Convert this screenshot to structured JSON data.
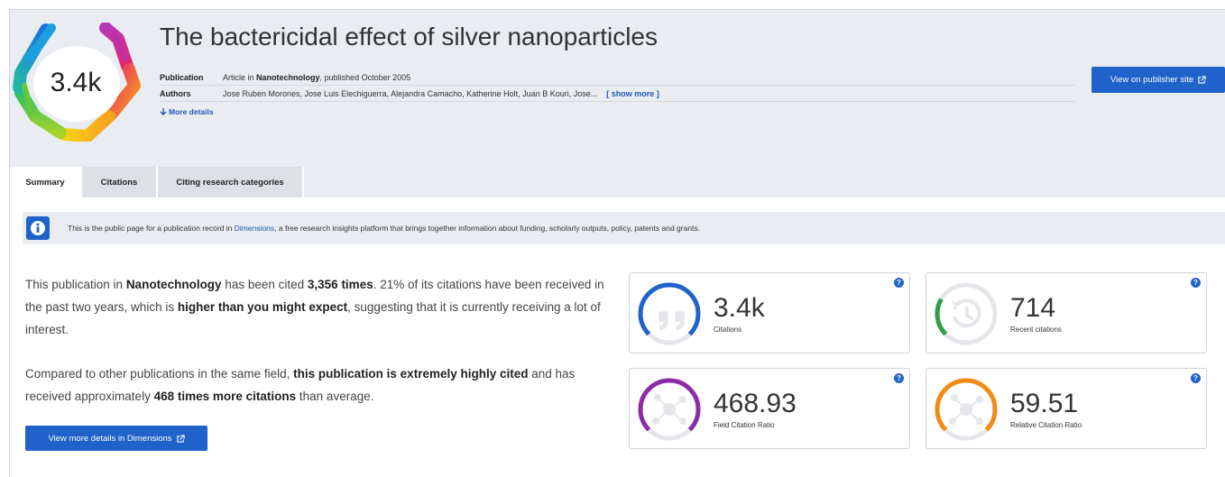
{
  "badge": {
    "value": "3.4k",
    "icon": "altmetric-hexagon-icon"
  },
  "publication": {
    "title": "The bactericidal effect of silver nanoparticles",
    "publication_label": "Publication",
    "publication_prefix": "Article in",
    "journal": "Nanotechnology",
    "publication_suffix": ", published October 2005",
    "authors_label": "Authors",
    "authors": "Jose Ruben Morones, Jose Luis Elechiguerra, Alejandra Camacho, Katherine Holt, Juan B Kouri, Jose...",
    "show_more": "[ show more ]",
    "more_details": "More details"
  },
  "actions": {
    "publisher_button": "View on publisher site",
    "dimensions_button": "View more details in Dimensions"
  },
  "tabs": [
    {
      "label": "Summary",
      "active": true
    },
    {
      "label": "Citations",
      "active": false
    },
    {
      "label": "Citing research categories",
      "active": false
    }
  ],
  "info": {
    "text_before": "This is the public page for a publication record in ",
    "link": "Dimensions",
    "text_after": ", a free research insights platform that brings together information about funding, scholarly outputs, policy, patents and grants."
  },
  "summary": {
    "p1_a": "This publication in ",
    "p1_journal": "Nanotechnology",
    "p1_b": " has been cited ",
    "p1_count": "3,356 times",
    "p1_c": ". 21% of its citations have been received in the past two years, which is ",
    "p1_expect": "higher than you might expect",
    "p1_d": ", suggesting that it is currently receiving a lot of interest.",
    "p2_a": "Compared to other publications in the same field, ",
    "p2_cited": "this publication is extremely highly cited",
    "p2_b": " and has received approximately ",
    "p2_times": "468 times more citations",
    "p2_c": " than average."
  },
  "metrics": [
    {
      "value": "3.4k",
      "label": "Citations",
      "icon": "quote-icon",
      "color": "#1f62c9",
      "fill": 0.75
    },
    {
      "value": "714",
      "label": "Recent citations",
      "icon": "history-clock-icon",
      "color": "#2e9e49",
      "fill": 0.21
    },
    {
      "value": "468.93",
      "label": "Field Citation Ratio",
      "icon": "network-nodes-icon",
      "color": "#8d2aa6",
      "fill": 0.75
    },
    {
      "value": "59.51",
      "label": "Relative Citation Ratio",
      "icon": "network-nodes-icon",
      "color": "#f28b14",
      "fill": 0.75
    }
  ],
  "help_glyph": "?",
  "colors": {
    "accent": "#1f62c9",
    "header_bg": "#e9ecf0",
    "link": "#1f5ab1"
  }
}
